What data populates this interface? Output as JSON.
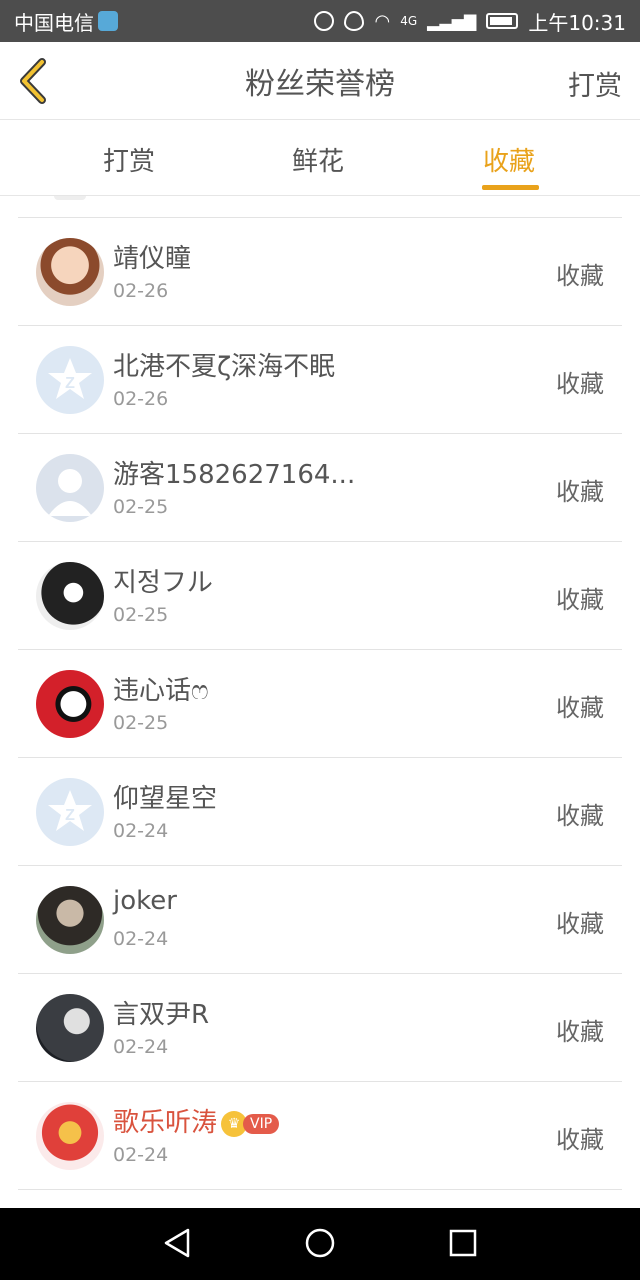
{
  "status_bar": {
    "carrier": "中国电信",
    "network": "4G",
    "time": "上午10:31"
  },
  "header": {
    "title": "粉丝荣誉榜",
    "right_action": "打赏",
    "back_icon": "chevron-left-icon"
  },
  "tabs": [
    {
      "label": "打赏",
      "active": false
    },
    {
      "label": "鲜花",
      "active": false
    },
    {
      "label": "收藏",
      "active": true
    }
  ],
  "accent_color": "#e9a21b",
  "rows": [
    {
      "name": "靖仪瞳",
      "date": "02-26",
      "action": "收藏",
      "avatar": "photo-avatar",
      "vip": false
    },
    {
      "name": "北港不夏ζ深海不眠",
      "date": "02-26",
      "action": "收藏",
      "avatar": "default-star-avatar",
      "vip": false
    },
    {
      "name": "游客1582627164...",
      "date": "02-25",
      "action": "收藏",
      "avatar": "default-user-avatar",
      "vip": false
    },
    {
      "name": "지정フル",
      "date": "02-25",
      "action": "收藏",
      "avatar": "anime-avatar",
      "vip": false
    },
    {
      "name": "违心话ෆ",
      "date": "02-25",
      "action": "收藏",
      "avatar": "anime-red-avatar",
      "vip": false
    },
    {
      "name": "仰望星空",
      "date": "02-24",
      "action": "收藏",
      "avatar": "default-star-avatar",
      "vip": false
    },
    {
      "name": "joker",
      "date": "02-24",
      "action": "收藏",
      "avatar": "photo-avatar",
      "vip": false
    },
    {
      "name": "言双尹R",
      "date": "02-24",
      "action": "收藏",
      "avatar": "photo-avatar",
      "vip": false
    },
    {
      "name": "歌乐听涛",
      "date": "02-24",
      "action": "收藏",
      "avatar": "cartoon-avatar",
      "vip": true,
      "vip_label": "VIP"
    }
  ]
}
